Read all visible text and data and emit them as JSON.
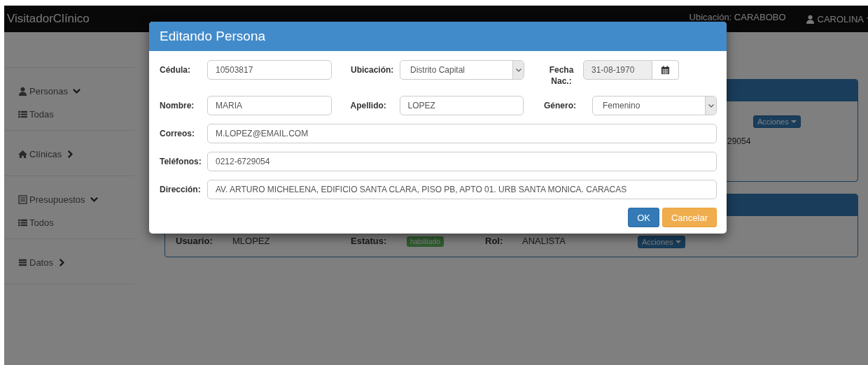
{
  "navbar": {
    "brand": "VisitadorClínico",
    "location": "Ubicación: CARABOBO",
    "user": "CAROLINA"
  },
  "sidebar": [
    {
      "label": "Personas",
      "kind": "person",
      "expanded": true,
      "children": [
        {
          "label": "Todas"
        }
      ]
    },
    {
      "label": "Clínicas",
      "kind": "home",
      "expanded": false
    },
    {
      "label": "Presupuestos",
      "kind": "budget",
      "expanded": true,
      "children": [
        {
          "label": "Todos"
        }
      ]
    },
    {
      "label": "Datos",
      "kind": "data",
      "expanded": false
    }
  ],
  "panels": [
    {
      "text": "29054",
      "action": "Acciones"
    },
    {
      "fields": [
        {
          "label": "Usuario:",
          "value": "MLOPEZ",
          "kind": "text"
        },
        {
          "label": "Estatus:",
          "value": "habilitado",
          "kind": "badge"
        },
        {
          "label": "Rol:",
          "value": "ANALISTA",
          "kind": "text"
        }
      ],
      "action": "Acciones"
    }
  ],
  "modal": {
    "title": "Editando Persona",
    "rows": [
      [
        {
          "label": "Cédula:",
          "kind": "text",
          "value": "10503817"
        },
        {
          "label": "Ubicación:",
          "kind": "select",
          "value": "Distrito Capital"
        },
        {
          "label": "Fecha Nac.:",
          "kind": "date",
          "value": "31-08-1970",
          "readonly": true
        }
      ],
      [
        {
          "label": "Nombre:",
          "kind": "text",
          "value": "MARIA"
        },
        {
          "label": "Apellido:",
          "kind": "text",
          "value": "LOPEZ"
        },
        {
          "label": "Género:",
          "kind": "select",
          "value": "Femenino"
        }
      ],
      [
        {
          "label": "Correos:",
          "kind": "text",
          "value": "M.LOPEZ@EMAIL.COM"
        }
      ],
      [
        {
          "label": "Teléfonos:",
          "kind": "text",
          "value": "0212-6729054"
        }
      ],
      [
        {
          "label": "Dirección:",
          "kind": "text",
          "value": "AV. ARTURO MICHELENA, EDIFICIO SANTA CLARA, PISO PB, APTO 01. URB SANTA MONICA. CARACAS"
        }
      ]
    ],
    "buttons": [
      {
        "label": "OK",
        "kind": "primary"
      },
      {
        "label": "Cancelar",
        "kind": "warning"
      }
    ]
  }
}
